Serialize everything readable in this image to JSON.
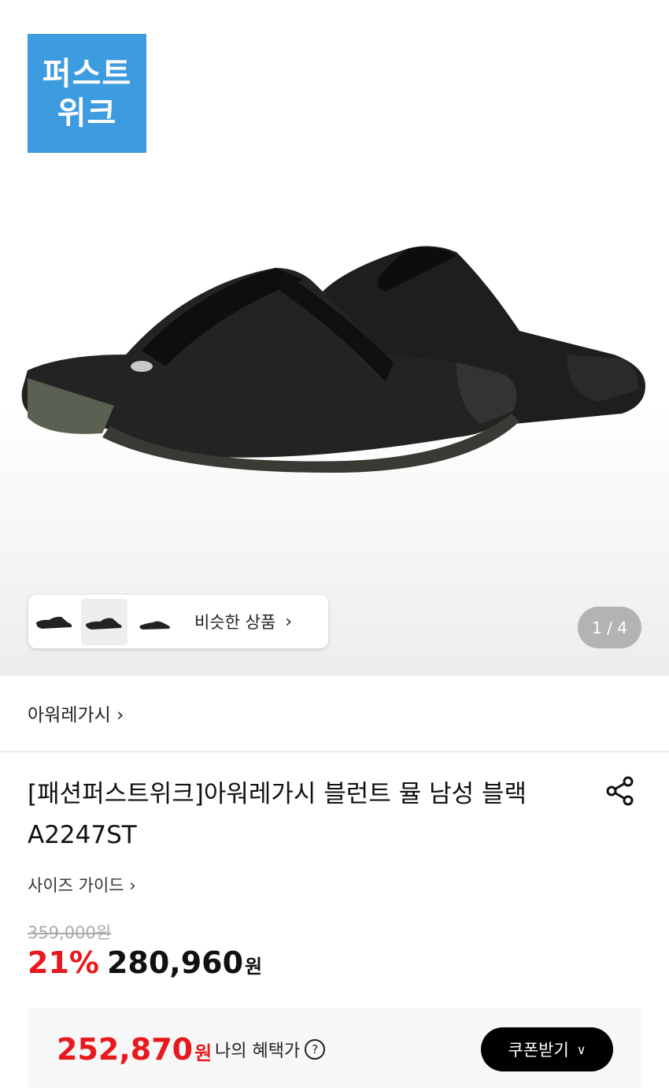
{
  "hero": {
    "logo_line1": "퍼스트",
    "logo_line2": "위크",
    "logo_color": "#3d9be0",
    "similar_label": "비슷한 상품",
    "counter": "1 / 4"
  },
  "brand": {
    "name": "아워레가시"
  },
  "product": {
    "title_line1": "[패션퍼스트위크]아워레가시 블런트 뮬 남성 블랙",
    "title_line2": "A2247ST",
    "size_guide": "사이즈 가이드"
  },
  "price": {
    "original": "359,000원",
    "discount": "21%",
    "sale": "280,960",
    "currency": "원"
  },
  "benefit": {
    "price": "252,870",
    "currency": "원",
    "label": "나의 혜택가",
    "coupon_label": "쿠폰받기"
  },
  "colors": {
    "accent_red": "#e8191e",
    "button_black": "#000000"
  }
}
